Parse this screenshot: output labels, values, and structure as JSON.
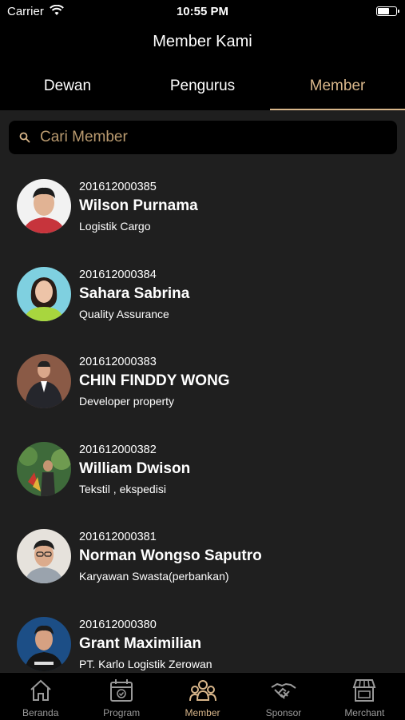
{
  "status": {
    "carrier": "Carrier",
    "time": "10:55 PM"
  },
  "nav": {
    "title": "Member Kami"
  },
  "tabs": [
    {
      "label": "Dewan",
      "active": false
    },
    {
      "label": "Pengurus",
      "active": false
    },
    {
      "label": "Member",
      "active": true
    }
  ],
  "search": {
    "placeholder": "Cari Member"
  },
  "members": [
    {
      "id": "201612000385",
      "name": "Wilson Purnama",
      "job": "Logistik Cargo"
    },
    {
      "id": "201612000384",
      "name": "Sahara Sabrina",
      "job": "Quality Assurance"
    },
    {
      "id": "201612000383",
      "name": "CHIN FINDDY WONG",
      "job": "Developer property"
    },
    {
      "id": "201612000382",
      "name": "William Dwison",
      "job": "Tekstil , ekspedisi"
    },
    {
      "id": "201612000381",
      "name": "Norman Wongso Saputro",
      "job": "Karyawan Swasta(perbankan)"
    },
    {
      "id": "201612000380",
      "name": "Grant Maximilian",
      "job": "PT. Karlo Logistik Zerowan"
    }
  ],
  "tabbar": [
    {
      "label": "Beranda",
      "icon": "home-icon"
    },
    {
      "label": "Program",
      "icon": "calendar-icon"
    },
    {
      "label": "Member",
      "icon": "members-icon",
      "active": true
    },
    {
      "label": "Sponsor",
      "icon": "handshake-icon"
    },
    {
      "label": "Merchant",
      "icon": "store-icon"
    }
  ],
  "colors": {
    "accent": "#d8b68a",
    "background": "#1f1f1f",
    "bar": "#000000"
  }
}
